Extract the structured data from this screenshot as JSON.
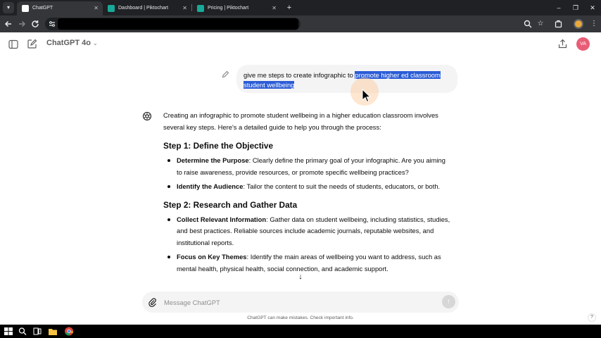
{
  "browser": {
    "tabs": [
      {
        "label": "ChatGPT",
        "active": true,
        "favicon_color": "#ffffff"
      },
      {
        "label": "Dashboard | Piktochart",
        "active": false,
        "favicon_color": "#18a999"
      },
      {
        "label": "Pricing | Piktochart",
        "active": false,
        "favicon_color": "#18a999"
      }
    ],
    "close_glyph": "✕",
    "new_tab_glyph": "+",
    "window_controls": [
      "–",
      "❐",
      "✕"
    ],
    "icons": [
      "tab-search-icon",
      "back-icon",
      "forward-icon",
      "reload-icon",
      "site-info-icon",
      "zoom-icon",
      "bookmark-star-icon",
      "extensions-icon",
      "profile-icon",
      "menu-icon"
    ]
  },
  "app": {
    "model_label": "ChatGPT 4o",
    "avatar_initials": "VA",
    "accent_color": "#e85d75"
  },
  "conversation": {
    "user_message": {
      "plain": "give me steps to create infographic to ",
      "selected": "promote higher ed classroom student wellbeing"
    },
    "assistant": {
      "intro": "Creating an infographic to promote student wellbeing in a higher education classroom involves several key steps. Here's a detailed guide to help you through the process:",
      "steps": [
        {
          "heading": "Step 1: Define the Objective",
          "bullets": [
            {
              "term": "Determine the Purpose",
              "text": ": Clearly define the primary goal of your infographic. Are you aiming to raise awareness, provide resources, or promote specific wellbeing practices?"
            },
            {
              "term": "Identify the Audience",
              "text": ": Tailor the content to suit the needs of students, educators, or both."
            }
          ]
        },
        {
          "heading": "Step 2: Research and Gather Data",
          "bullets": [
            {
              "term": "Collect Relevant Information",
              "text": ": Gather data on student wellbeing, including statistics, studies, and best practices. Reliable sources include academic journals, reputable websites, and institutional reports."
            },
            {
              "term": "Focus on Key Themes",
              "text": ": Identify the main areas of wellbeing you want to address, such as mental health, physical health, social connection, and academic support."
            }
          ]
        }
      ]
    }
  },
  "composer": {
    "placeholder": "Message ChatGPT",
    "scroll_glyph": "↓",
    "send_glyph": "↑"
  },
  "footer": {
    "disclaimer": "ChatGPT can make mistakes. Check important info.",
    "help_label": "?"
  }
}
